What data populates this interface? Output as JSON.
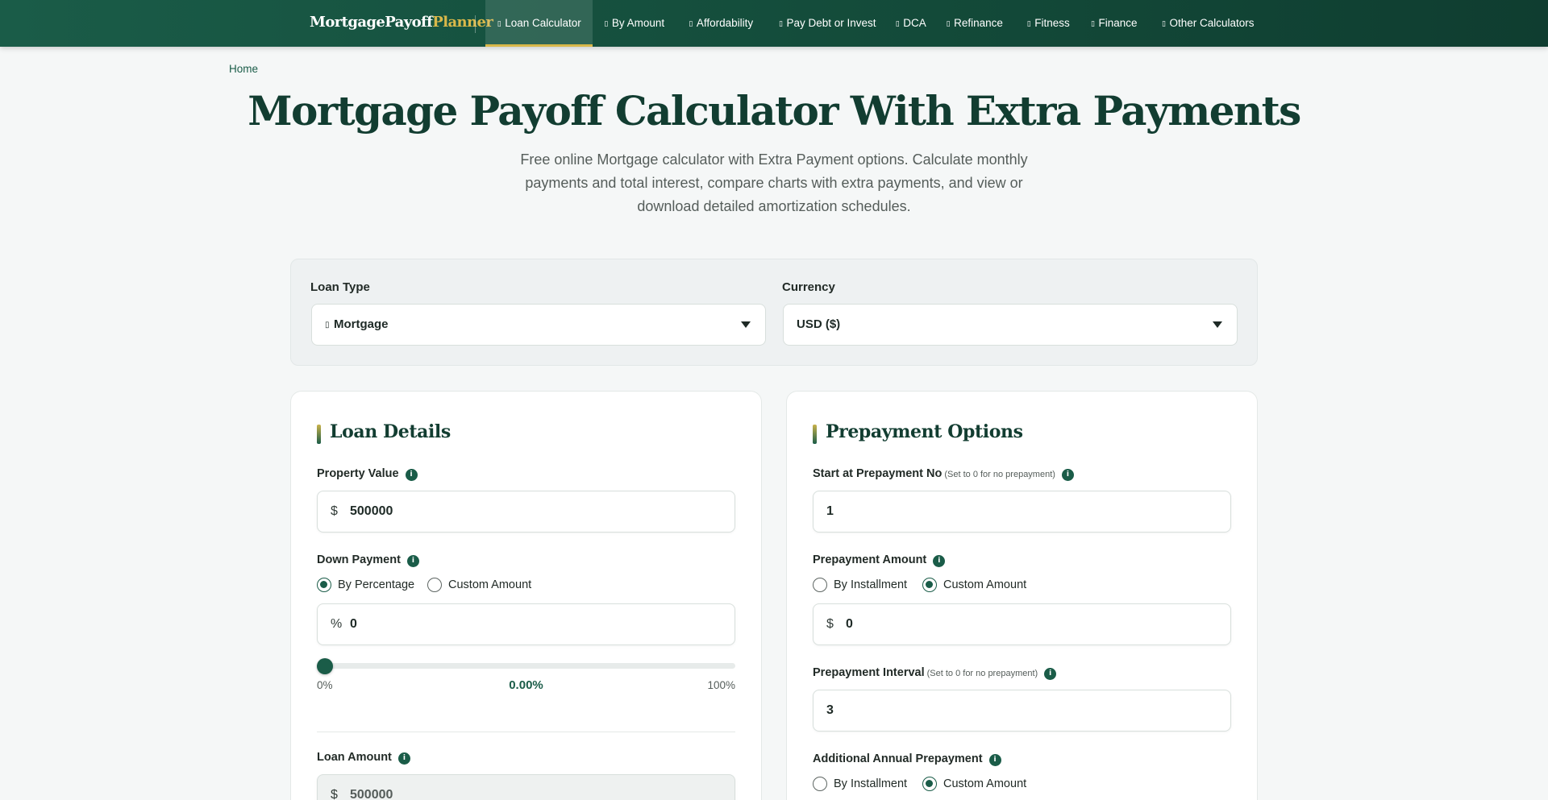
{
  "brand": {
    "name_main": "MortgagePayoff",
    "name_accent": "Planner"
  },
  "nav": {
    "items": [
      {
        "label": "Loan Calculator",
        "glyph": "▯"
      },
      {
        "label": "By Amount",
        "glyph": "▯"
      },
      {
        "label": "Affordability",
        "glyph": "▯"
      },
      {
        "label": "Pay Debt or Invest",
        "glyph": "▯"
      },
      {
        "label": "DCA",
        "glyph": "▯"
      },
      {
        "label": "Refinance",
        "glyph": "▯"
      },
      {
        "label": "Fitness",
        "glyph": "▯"
      },
      {
        "label": "Finance",
        "glyph": "▯"
      },
      {
        "label": "Other Calculators",
        "glyph": "▯"
      }
    ],
    "active_index": 0
  },
  "breadcrumb": {
    "home": "Home"
  },
  "page": {
    "title": "Mortgage Payoff Calculator With Extra Payments",
    "subtitle": "Free online Mortgage calculator with Extra Payment options. Calculate monthly payments and total interest, compare charts with extra payments, and view or download detailed amortization schedules."
  },
  "selectors": {
    "loan_type_label": "Loan Type",
    "loan_type_value": "Mortgage",
    "loan_type_glyph": "▯",
    "currency_label": "Currency",
    "currency_value": "USD ($)"
  },
  "loan_details": {
    "title": "Loan Details",
    "info_glyph": "i",
    "property_value_label": "Property Value",
    "property_value_prefix": "$",
    "property_value": "500000",
    "down_payment_label": "Down Payment",
    "down_payment_modes": [
      "By Percentage",
      "Custom Amount"
    ],
    "down_payment_selected": 0,
    "down_payment_prefix": "%",
    "down_payment_value": "0",
    "slider": {
      "min_label": "0%",
      "max_label": "100%",
      "value_label": "0.00%",
      "fraction": 0
    },
    "loan_amount_label": "Loan Amount",
    "loan_amount_prefix": "$",
    "loan_amount_value": "500000"
  },
  "prepayment": {
    "title": "Prepayment Options",
    "info_glyph": "i",
    "start_label": "Start at Prepayment No",
    "start_hint": "(Set to 0 for no prepayment)",
    "start_value": "1",
    "amount_label": "Prepayment Amount",
    "amount_modes": [
      "By Installment",
      "Custom Amount"
    ],
    "amount_selected": 1,
    "amount_prefix": "$",
    "amount_value": "0",
    "interval_label": "Prepayment Interval",
    "interval_hint": "(Set to 0 for no prepayment)",
    "interval_value": "3",
    "annual_label": "Additional Annual Prepayment",
    "annual_modes": [
      "By Installment",
      "Custom Amount"
    ],
    "annual_selected": 1
  },
  "colors": {
    "brand_green": "#1a5c48",
    "accent_gold": "#d9b84a",
    "title_green": "#123d31"
  }
}
